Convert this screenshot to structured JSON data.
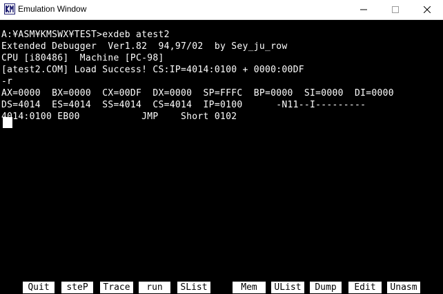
{
  "window": {
    "title": "Emulation Window",
    "icon": "kmswx-app-icon",
    "controls": [
      "minimize-icon",
      "maximize-icon",
      "close-icon"
    ]
  },
  "terminal": {
    "lines": [
      "A:¥ASM¥KMSWX¥TEST>exdeb atest2",
      "Extended Debugger  Ver1.82  94,97/02  by Sey_ju_row",
      "CPU [i80486]  Machine [PC-98]",
      "[atest2.COM] Load Success! CS:IP=4014:0100 + 0000:00DF",
      "-r",
      "AX=0000  BX=0000  CX=00DF  DX=0000  SP=FFFC  BP=0000  SI=0000  DI=0000",
      "DS=4014  ES=4014  SS=4014  CS=4014  IP=0100      -N11--I---------",
      "4014:0100 EB00           JMP    Short 0102"
    ]
  },
  "function_keys": [
    {
      "label": "Quit"
    },
    {
      "label": "steP"
    },
    {
      "label": "Trace"
    },
    {
      "label": "run"
    },
    {
      "label": "SList"
    },
    {
      "label": "Mem"
    },
    {
      "label": "UList"
    },
    {
      "label": "Dump"
    },
    {
      "label": "Edit"
    },
    {
      "label": "Unasm"
    }
  ],
  "colors": {
    "terminal_bg": "#000000",
    "terminal_fg": "#ffffff",
    "fkey_bg": "#ffffff",
    "fkey_fg": "#000000"
  }
}
